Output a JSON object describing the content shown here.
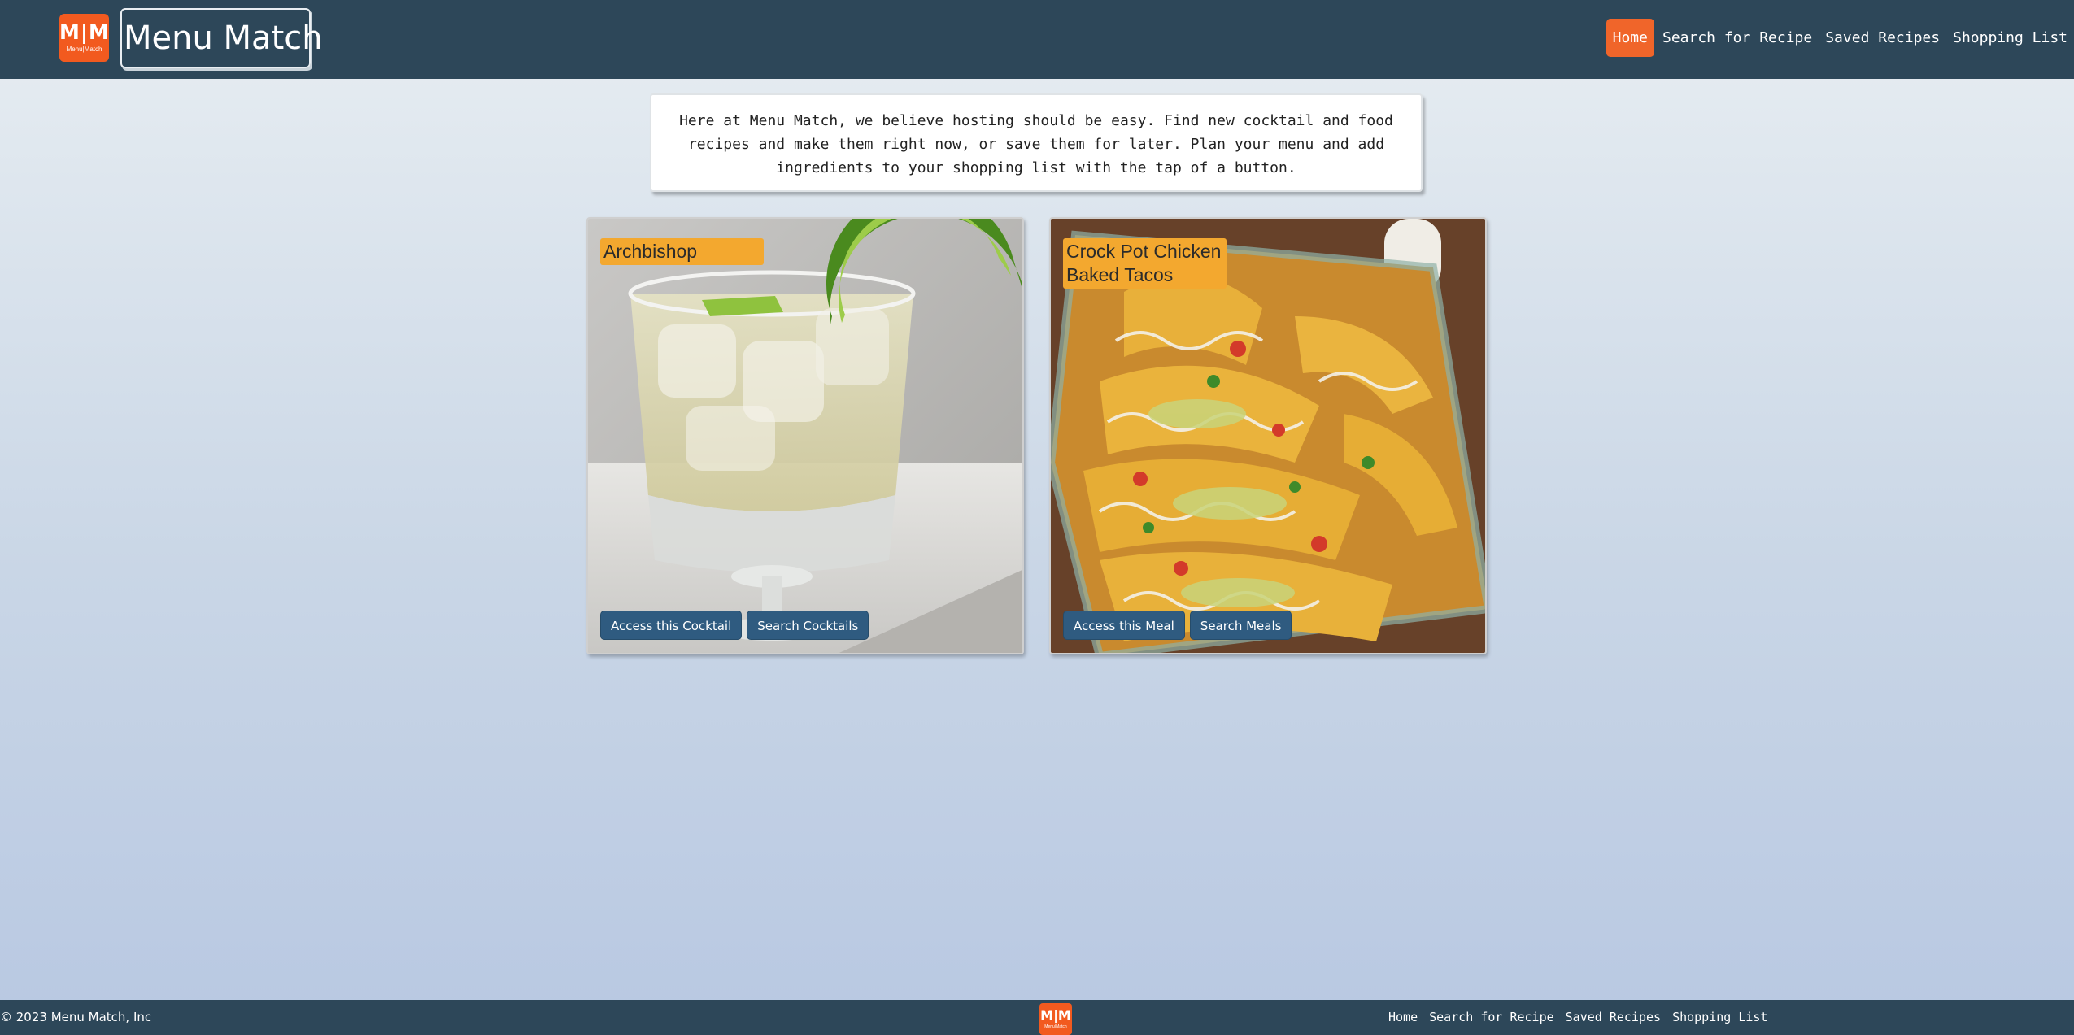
{
  "header": {
    "logo_text": "M|M",
    "logo_subtext": "Menu|Match",
    "brand": "Menu Match",
    "nav": [
      {
        "label": "Home",
        "active": true
      },
      {
        "label": "Search for Recipe",
        "active": false
      },
      {
        "label": "Saved Recipes",
        "active": false
      },
      {
        "label": "Shopping List",
        "active": false
      }
    ]
  },
  "intro": {
    "text": "Here at Menu Match, we believe hosting should be easy. Find new cocktail and food recipes and make them right now, or save them for later. Plan your menu and add ingredients to your shopping list with the tap of a button."
  },
  "cards": [
    {
      "title": "Archbishop",
      "image_icon": "cocktail-glass-with-lime",
      "primary_button": "Access this Cocktail",
      "secondary_button": "Search Cocktails"
    },
    {
      "title": "Crock Pot Chicken Baked Tacos",
      "image_icon": "baked-tacos-dish",
      "primary_button": "Access this Meal",
      "secondary_button": "Search Meals"
    }
  ],
  "footer": {
    "copyright": "© 2023 Menu Match, Inc",
    "logo_text": "M|M",
    "logo_subtext": "Menu|Match",
    "nav": [
      "Home",
      "Search for Recipe",
      "Saved Recipes",
      "Shopping List"
    ]
  },
  "colors": {
    "header_bg": "#2d4759",
    "accent_orange": "#f25a1f",
    "title_badge": "#f3a82f",
    "button_blue": "#2f5b80"
  }
}
